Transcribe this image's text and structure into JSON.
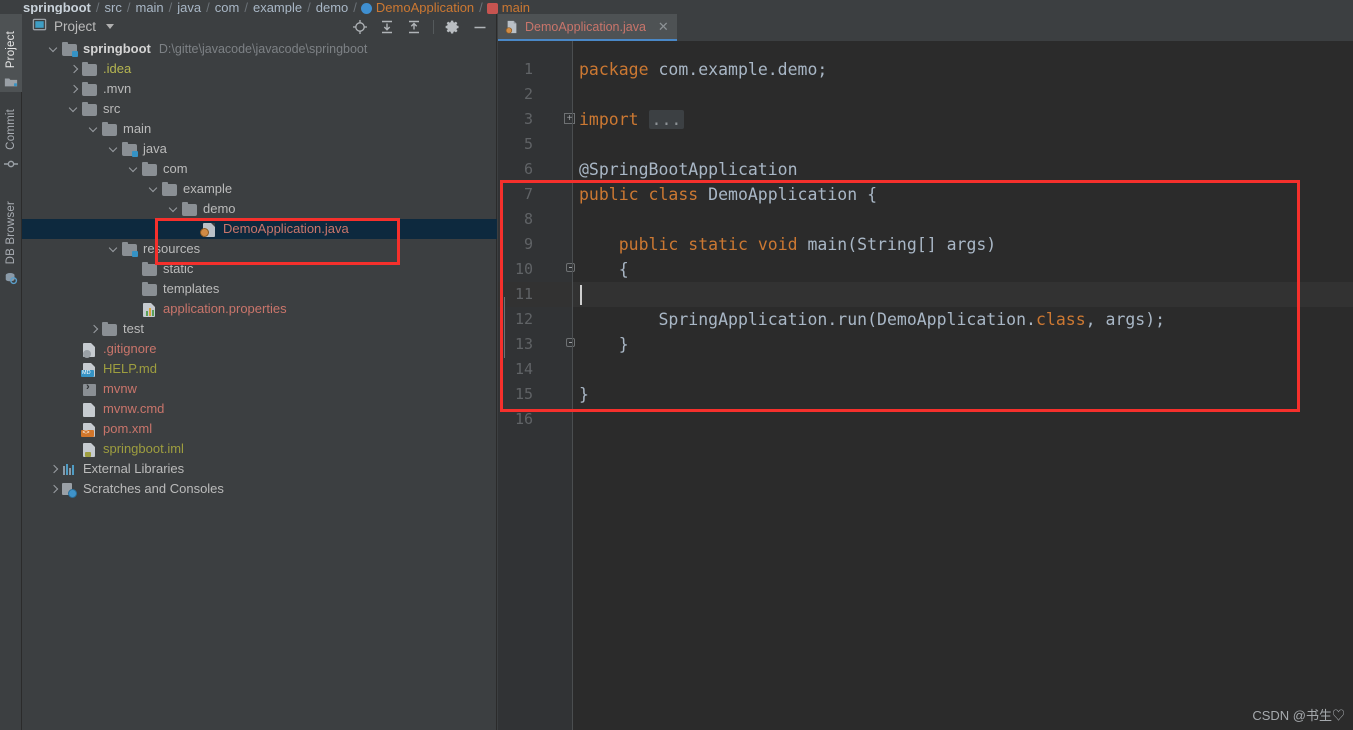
{
  "breadcrumb": {
    "items": [
      {
        "label": "springboot",
        "style": "bold"
      },
      {
        "label": "src",
        "style": "plain"
      },
      {
        "label": "main",
        "style": "plain"
      },
      {
        "label": "java",
        "style": "plain"
      },
      {
        "label": "com",
        "style": "plain"
      },
      {
        "label": "example",
        "style": "plain"
      },
      {
        "label": "demo",
        "style": "plain"
      },
      {
        "label": "DemoApplication",
        "style": "class"
      },
      {
        "label": "main",
        "style": "method"
      }
    ],
    "separator": "/"
  },
  "toolwindow_tabs": [
    {
      "label": "Project",
      "icon": "project-folder-icon",
      "active": true
    },
    {
      "label": "Commit",
      "icon": "commit-icon",
      "active": false
    },
    {
      "label": "DB Browser",
      "icon": "database-browser-icon",
      "active": false
    }
  ],
  "project_panel": {
    "title": "Project",
    "title_icon": "project-window-icon",
    "dropdown_icon": "chevron-down-icon",
    "toolbar": [
      {
        "name": "select-opened-file-icon",
        "tooltip": "Select Opened File"
      },
      {
        "name": "expand-all-icon",
        "tooltip": "Expand All"
      },
      {
        "name": "collapse-all-icon",
        "tooltip": "Collapse All"
      },
      {
        "name": "settings-gear-icon",
        "tooltip": "Settings"
      },
      {
        "name": "hide-icon",
        "tooltip": "Hide"
      }
    ]
  },
  "tree": [
    {
      "label": "springboot",
      "path": "D:\\gitte\\javacode\\javacode\\springboot",
      "depth": 0,
      "arrow": "down",
      "icon": "module-folder-icon",
      "color": "bold",
      "selected": false
    },
    {
      "label": ".idea",
      "depth": 1,
      "arrow": "right",
      "icon": "folder-icon",
      "color": "yellow",
      "selected": false
    },
    {
      "label": ".mvn",
      "depth": 1,
      "arrow": "right",
      "icon": "folder-icon",
      "color": "plain",
      "selected": false
    },
    {
      "label": "src",
      "depth": 1,
      "arrow": "down",
      "icon": "folder-icon",
      "color": "plain",
      "selected": false
    },
    {
      "label": "main",
      "depth": 2,
      "arrow": "down",
      "icon": "folder-icon",
      "color": "plain",
      "selected": false
    },
    {
      "label": "java",
      "depth": 3,
      "arrow": "down",
      "icon": "source-folder-icon",
      "color": "plain",
      "selected": false
    },
    {
      "label": "com",
      "depth": 4,
      "arrow": "down",
      "icon": "package-folder-icon",
      "color": "plain",
      "selected": false
    },
    {
      "label": "example",
      "depth": 5,
      "arrow": "down",
      "icon": "package-folder-icon",
      "color": "plain",
      "selected": false
    },
    {
      "label": "demo",
      "depth": 6,
      "arrow": "down",
      "icon": "package-folder-icon",
      "color": "plain",
      "selected": false
    },
    {
      "label": "DemoApplication.java",
      "depth": 7,
      "arrow": "none",
      "icon": "spring-boot-java-file-icon",
      "color": "red",
      "selected": true
    },
    {
      "label": "resources",
      "depth": 3,
      "arrow": "down",
      "icon": "resources-folder-icon",
      "color": "plain",
      "selected": false
    },
    {
      "label": "static",
      "depth": 4,
      "arrow": "none",
      "icon": "folder-icon",
      "color": "plain",
      "selected": false
    },
    {
      "label": "templates",
      "depth": 4,
      "arrow": "none",
      "icon": "folder-icon",
      "color": "plain",
      "selected": false
    },
    {
      "label": "application.properties",
      "depth": 4,
      "arrow": "none",
      "icon": "spring-properties-file-icon",
      "color": "red",
      "selected": false
    },
    {
      "label": "test",
      "depth": 2,
      "arrow": "right",
      "icon": "test-folder-icon",
      "color": "plain",
      "selected": false
    },
    {
      "label": ".gitignore",
      "depth": 1,
      "arrow": "none",
      "icon": "gitignore-file-icon",
      "color": "red",
      "selected": false
    },
    {
      "label": "HELP.md",
      "depth": 1,
      "arrow": "none",
      "icon": "markdown-file-icon",
      "color": "olive",
      "selected": false
    },
    {
      "label": "mvnw",
      "depth": 1,
      "arrow": "none",
      "icon": "shell-script-file-icon",
      "color": "red",
      "selected": false
    },
    {
      "label": "mvnw.cmd",
      "depth": 1,
      "arrow": "none",
      "icon": "cmd-file-icon",
      "color": "red",
      "selected": false
    },
    {
      "label": "pom.xml",
      "depth": 1,
      "arrow": "none",
      "icon": "maven-xml-file-icon",
      "color": "red",
      "selected": false
    },
    {
      "label": "springboot.iml",
      "depth": 1,
      "arrow": "none",
      "icon": "iml-file-icon",
      "color": "olive",
      "selected": false
    },
    {
      "label": "External Libraries",
      "depth": 0,
      "arrow": "right",
      "icon": "external-libraries-icon",
      "color": "plain",
      "selected": false
    },
    {
      "label": "Scratches and Consoles",
      "depth": 0,
      "arrow": "right",
      "icon": "scratches-icon",
      "color": "plain",
      "selected": false
    }
  ],
  "editor": {
    "tab": {
      "label": "DemoApplication.java",
      "icon": "spring-boot-java-file-icon",
      "close_icon": "close-icon"
    },
    "line_numbers": [
      "1",
      "2",
      "3",
      "5",
      "6",
      "7",
      "8",
      "9",
      "10",
      "11",
      "12",
      "13",
      "14",
      "15",
      "16"
    ],
    "current_line": 11,
    "lines": [
      {
        "n": "1",
        "tokens": [
          {
            "t": "package",
            "c": "kw"
          },
          {
            "t": " com.example.demo;",
            "c": "pln"
          }
        ]
      },
      {
        "n": "2",
        "tokens": []
      },
      {
        "n": "3",
        "tokens": [
          {
            "t": "import",
            "c": "kw"
          },
          {
            "t": " ",
            "c": "pln"
          },
          {
            "t": "...",
            "c": "fold"
          }
        ],
        "fold": "plus"
      },
      {
        "n": "5",
        "tokens": []
      },
      {
        "n": "6",
        "tokens": [
          {
            "t": "@SpringBootApplication",
            "c": "pln"
          }
        ]
      },
      {
        "n": "7",
        "tokens": [
          {
            "t": "public class ",
            "c": "kw"
          },
          {
            "t": "DemoApplication",
            "c": "pln"
          },
          {
            "t": " {",
            "c": "pln"
          }
        ]
      },
      {
        "n": "8",
        "tokens": []
      },
      {
        "n": "9",
        "tokens": [
          {
            "t": "    ",
            "c": "pln"
          },
          {
            "t": "public static void ",
            "c": "kw"
          },
          {
            "t": "main(String[] args)",
            "c": "pln"
          }
        ]
      },
      {
        "n": "10",
        "tokens": [
          {
            "t": "    {",
            "c": "pln"
          }
        ],
        "fold": "top"
      },
      {
        "n": "11",
        "tokens": []
      },
      {
        "n": "12",
        "tokens": [
          {
            "t": "        SpringApplication.run(DemoApplication.",
            "c": "pln"
          },
          {
            "t": "class",
            "c": "kw"
          },
          {
            "t": ", args);",
            "c": "pln"
          }
        ]
      },
      {
        "n": "13",
        "tokens": [
          {
            "t": "    }",
            "c": "pln"
          }
        ],
        "fold": "bot"
      },
      {
        "n": "14",
        "tokens": []
      },
      {
        "n": "15",
        "tokens": [
          {
            "t": "}",
            "c": "pln"
          }
        ]
      },
      {
        "n": "16",
        "tokens": []
      }
    ]
  },
  "annotations": {
    "tree_highlight_box": "red-rectangle-around-demoapplication-file",
    "code_highlight_box": "red-rectangle-around-main-method",
    "color": "#f5302c"
  },
  "watermark": "CSDN @书生♡"
}
